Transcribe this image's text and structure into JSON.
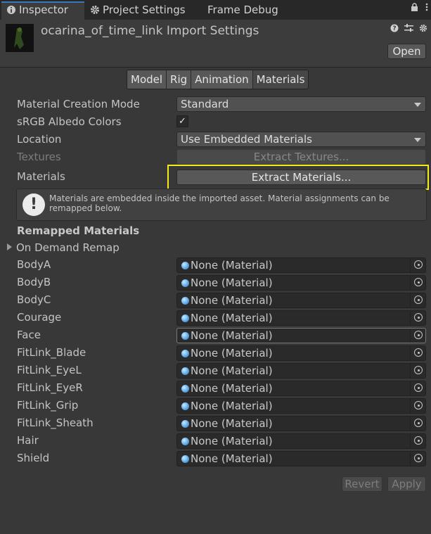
{
  "tabs": [
    {
      "label": "Inspector",
      "icon": "info-icon"
    },
    {
      "label": "Project Settings",
      "icon": "gear-icon"
    },
    {
      "label": "Frame Debug"
    }
  ],
  "header": {
    "title": "ocarina_of_time_link Import Settings",
    "open_label": "Open"
  },
  "subtabs": [
    "Model",
    "Rig",
    "Animation",
    "Materials"
  ],
  "active_subtab": "Materials",
  "props": {
    "creation_mode_label": "Material Creation Mode",
    "creation_mode_value": "Standard",
    "srgb_label": "sRGB Albedo Colors",
    "srgb_checked": "✓",
    "location_label": "Location",
    "location_value": "Use Embedded Materials",
    "textures_label": "Textures",
    "extract_textures_label": "Extract Textures...",
    "materials_label": "Materials",
    "extract_materials_label": "Extract Materials..."
  },
  "help": {
    "icon": "!",
    "text": "Materials are embedded inside the imported asset. Material assignments can be remapped below."
  },
  "remapped": {
    "title": "Remapped Materials",
    "foldout_label": "On Demand Remap",
    "items": [
      {
        "label": "BodyA",
        "value": "None (Material)"
      },
      {
        "label": "BodyB",
        "value": "None (Material)"
      },
      {
        "label": "BodyC",
        "value": "None (Material)"
      },
      {
        "label": "Courage",
        "value": "None (Material)"
      },
      {
        "label": "Face",
        "value": "None (Material)"
      },
      {
        "label": "FitLink_Blade",
        "value": "None (Material)"
      },
      {
        "label": "FitLink_EyeL",
        "value": "None (Material)"
      },
      {
        "label": "FitLink_EyeR",
        "value": "None (Material)"
      },
      {
        "label": "FitLink_Grip",
        "value": "None (Material)"
      },
      {
        "label": "FitLink_Sheath",
        "value": "None (Material)"
      },
      {
        "label": "Hair",
        "value": "None (Material)"
      },
      {
        "label": "Shield",
        "value": "None (Material)"
      }
    ]
  },
  "footer": {
    "revert_label": "Revert",
    "apply_label": "Apply"
  },
  "colors": {
    "highlight": "#f5ea1a",
    "active_tab_accent": "#3a79bb"
  }
}
